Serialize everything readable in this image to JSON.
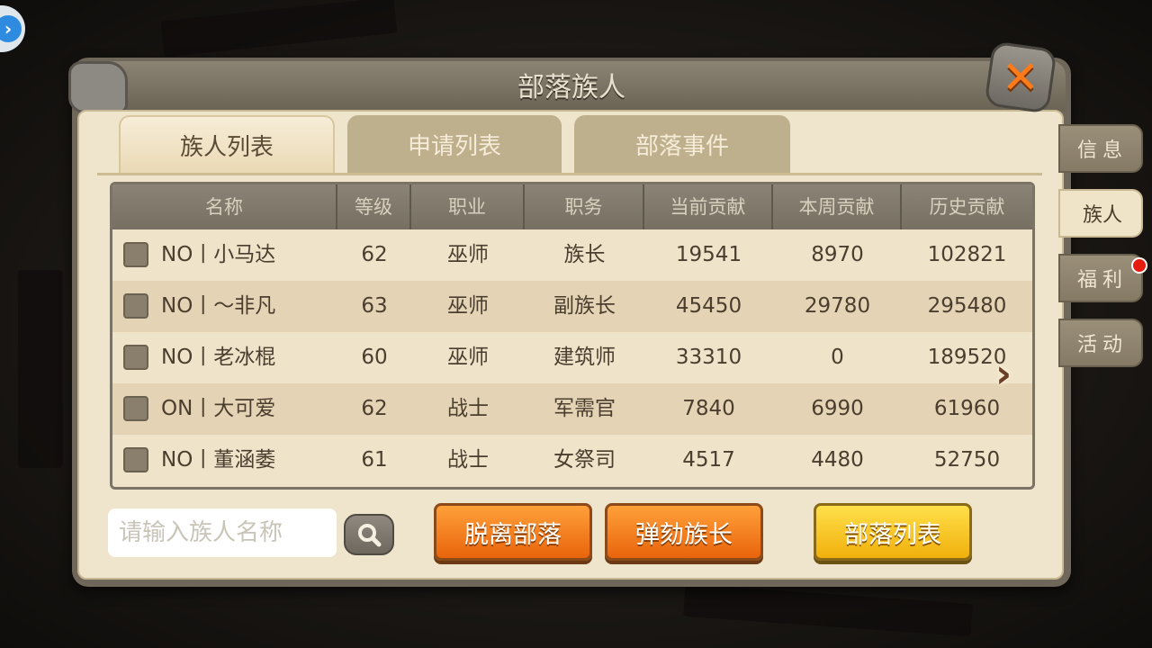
{
  "window": {
    "title": "部落族人"
  },
  "tabs": [
    {
      "label": "族人列表",
      "active": true
    },
    {
      "label": "申请列表",
      "active": false
    },
    {
      "label": "部落事件",
      "active": false
    }
  ],
  "table": {
    "headers": [
      "名称",
      "等级",
      "职业",
      "职务",
      "当前贡献",
      "本周贡献",
      "历史贡献"
    ],
    "rows": [
      {
        "name": "NO丨小马达",
        "level": "62",
        "job": "巫师",
        "role": "族长",
        "current": "19541",
        "week": "8970",
        "history": "102821"
      },
      {
        "name": "NO丨～非凡",
        "level": "63",
        "job": "巫师",
        "role": "副族长",
        "current": "45450",
        "week": "29780",
        "history": "295480"
      },
      {
        "name": "NO丨老冰棍",
        "level": "60",
        "job": "巫师",
        "role": "建筑师",
        "current": "33310",
        "week": "0",
        "history": "189520"
      },
      {
        "name": "ON丨大可爱",
        "level": "62",
        "job": "战士",
        "role": "军需官",
        "current": "7840",
        "week": "6990",
        "history": "61960"
      },
      {
        "name": "NO丨董涵萎",
        "level": "61",
        "job": "战士",
        "role": "女祭司",
        "current": "4517",
        "week": "4480",
        "history": "52750"
      }
    ]
  },
  "search": {
    "placeholder": "请输入族人名称",
    "value": ""
  },
  "buttons": {
    "leave": "脱离部落",
    "impeach": "弹劾族长",
    "tribe_list": "部落列表"
  },
  "side_tabs": [
    {
      "label": "信息",
      "active": false
    },
    {
      "label": "族人",
      "active": true
    },
    {
      "label": "福利",
      "active": false,
      "badge": true
    },
    {
      "label": "活动",
      "active": false
    }
  ],
  "icons": {
    "close": "close-icon",
    "search": "search-icon",
    "next": "chevron-right-icon",
    "float": "chevron-right-icon"
  },
  "colors": {
    "accent_orange": "#e9640c",
    "accent_yellow": "#f0b00c",
    "badge_red": "#e51b0e",
    "parchment": "#efe4cc"
  }
}
